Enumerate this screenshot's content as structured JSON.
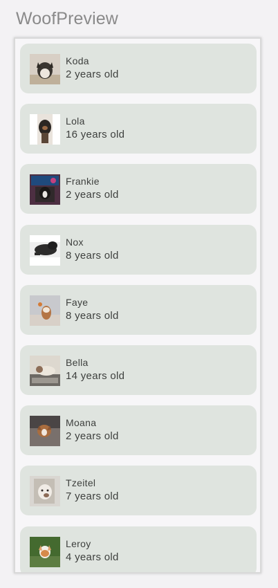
{
  "preview": {
    "title": "WoofPreview"
  },
  "dogs": [
    {
      "name": "Koda",
      "age": "2 years old",
      "photo_icon": "koda-photo"
    },
    {
      "name": "Lola",
      "age": "16 years old",
      "photo_icon": "lola-photo"
    },
    {
      "name": "Frankie",
      "age": "2 years old",
      "photo_icon": "frankie-photo"
    },
    {
      "name": "Nox",
      "age": "8 years old",
      "photo_icon": "nox-photo"
    },
    {
      "name": "Faye",
      "age": "8 years old",
      "photo_icon": "faye-photo"
    },
    {
      "name": "Bella",
      "age": "14 years old",
      "photo_icon": "bella-photo"
    },
    {
      "name": "Moana",
      "age": "2 years old",
      "photo_icon": "moana-photo"
    },
    {
      "name": "Tzeitel",
      "age": "7 years old",
      "photo_icon": "tzeitel-photo"
    },
    {
      "name": "Leroy",
      "age": "4 years old",
      "photo_icon": "leroy-photo"
    }
  ],
  "colors": {
    "background": "#f3f2f4",
    "card": "#dfe4df",
    "text": "#3d3f3d",
    "title": "#8a8a8a"
  }
}
